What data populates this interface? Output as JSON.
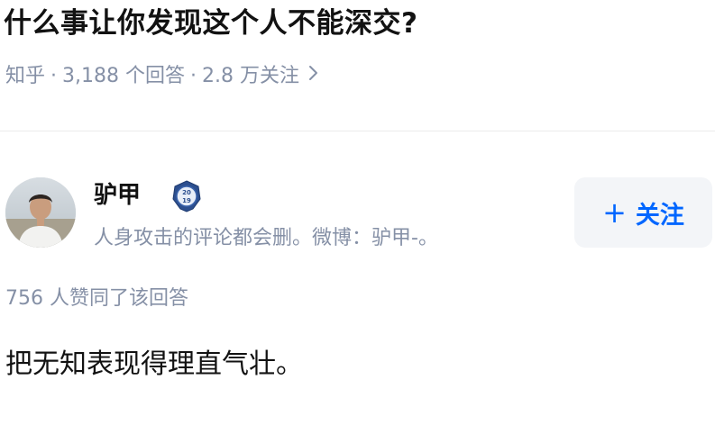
{
  "question": {
    "title": "什么事让你发现这个人不能深交?",
    "source": "知乎",
    "answers_count": "3,188 个回答",
    "followers_count": "2.8 万关注",
    "separator": "·"
  },
  "author": {
    "name": "驴甲",
    "badge_year_top": "20",
    "badge_year_bottom": "19",
    "bio": "人身攻击的评论都会删。微博：驴甲-。",
    "follow_label": "关注",
    "follow_plus": "+"
  },
  "answer": {
    "votes": "756 人赞同了该回答",
    "content": "把无知表现得理直气壮。"
  },
  "colors": {
    "accent": "#0066ff",
    "muted": "#8590a6",
    "text": "#121212",
    "button_bg": "#f3f5f8"
  },
  "icons": {
    "chevron": "chevron-right-icon",
    "badge": "badge-2019-icon",
    "avatar": "avatar"
  }
}
